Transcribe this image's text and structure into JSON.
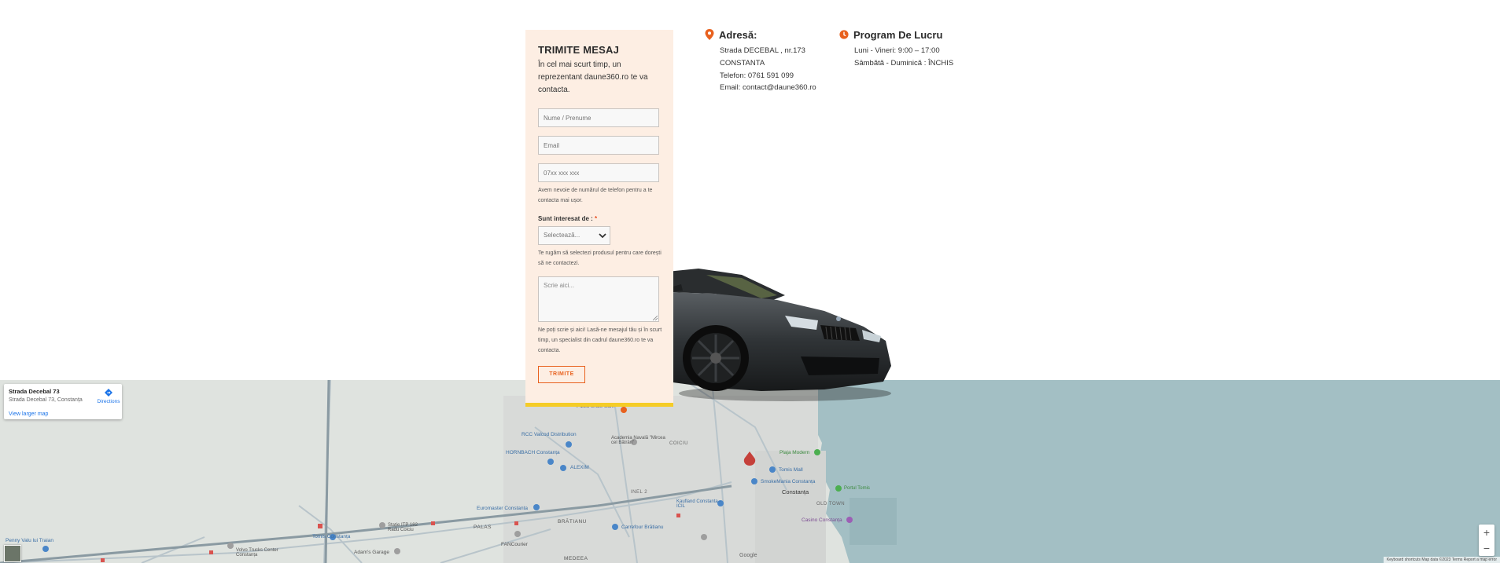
{
  "form": {
    "title": "TRIMITE MESAJ",
    "subtitle": "În cel mai scurt timp, un reprezentant daune360.ro te va contacta.",
    "name_placeholder": "Nume / Prenume",
    "email_placeholder": "Email",
    "phone_placeholder": "07xx xxx xxx",
    "phone_help": "Avem nevoie de numărul de telefon pentru a te contacta mai ușor.",
    "interest_label": "Sunt interesat de : ",
    "required_mark": "*",
    "select_value": "Selectează...",
    "select_help": "Te rugăm să selectezi produsul pentru care dorești să ne contactezi.",
    "message_placeholder": "Scrie aici...",
    "message_help": "Ne poți scrie și aici! Lasă-ne mesajul tău și în scurt timp, un specialist din cadrul daune360.ro te va contacta.",
    "submit_label": "TRIMITE"
  },
  "address": {
    "heading": "Adresă:",
    "icon": "location-pin-icon",
    "street": "Strada DECEBAL , nr.173",
    "city": "CONSTANTA",
    "phone": "Telefon: 0761 591 099",
    "email": "Email: contact@daune360.ro"
  },
  "schedule": {
    "heading": "Program De Lucru",
    "icon": "clock-icon",
    "weekdays": "Luni - Vineri: 9:00 – 17:00",
    "weekend": "Sâmbătă - Duminică : ÎNCHIS"
  },
  "map": {
    "place_name": "Strada Decebal 73",
    "place_address": "Strada Decebal 73, Constanța",
    "directions_label": "Directions",
    "larger_map_label": "View larger map",
    "zoom_in": "+",
    "zoom_out": "−",
    "footer": "Keyboard shortcuts   Map data ©2023   Terms   Report a map error",
    "labels": [
      "Pizza Unde Sam",
      "RCC Valcod Distribution",
      "Academia Navală \"Mircea cel Bătrân\"",
      "HORNBACH Constanța",
      "ALEXIM",
      "COICIU",
      "Plaja Modern",
      "Tomis Mall",
      "SmokeMania Constanța",
      "Constanța",
      "INEL 2",
      "Euromaster Constanta",
      "Kaufland Constanta - ICIL",
      "OLD TOWN",
      "Casino Constanța",
      "Portul Tomis",
      "BRĂTIANU",
      "Carrefour Brătianu",
      "Stație ITP 182 Radu Coiciu",
      "PALAS",
      "Tomis Constanța",
      "Volvo Trucks Center Constanța",
      "Adam's Garage",
      "FANCourier",
      "MEDEEA",
      "Penny Valu lui Traian",
      "Google"
    ],
    "colors": {
      "land": "#dfe3df",
      "sea": "#a3bfc4",
      "road": "#8a9aa2",
      "accent": "#e8611e",
      "panel": "#fdeee3",
      "stripe": "#f5cc27"
    }
  }
}
